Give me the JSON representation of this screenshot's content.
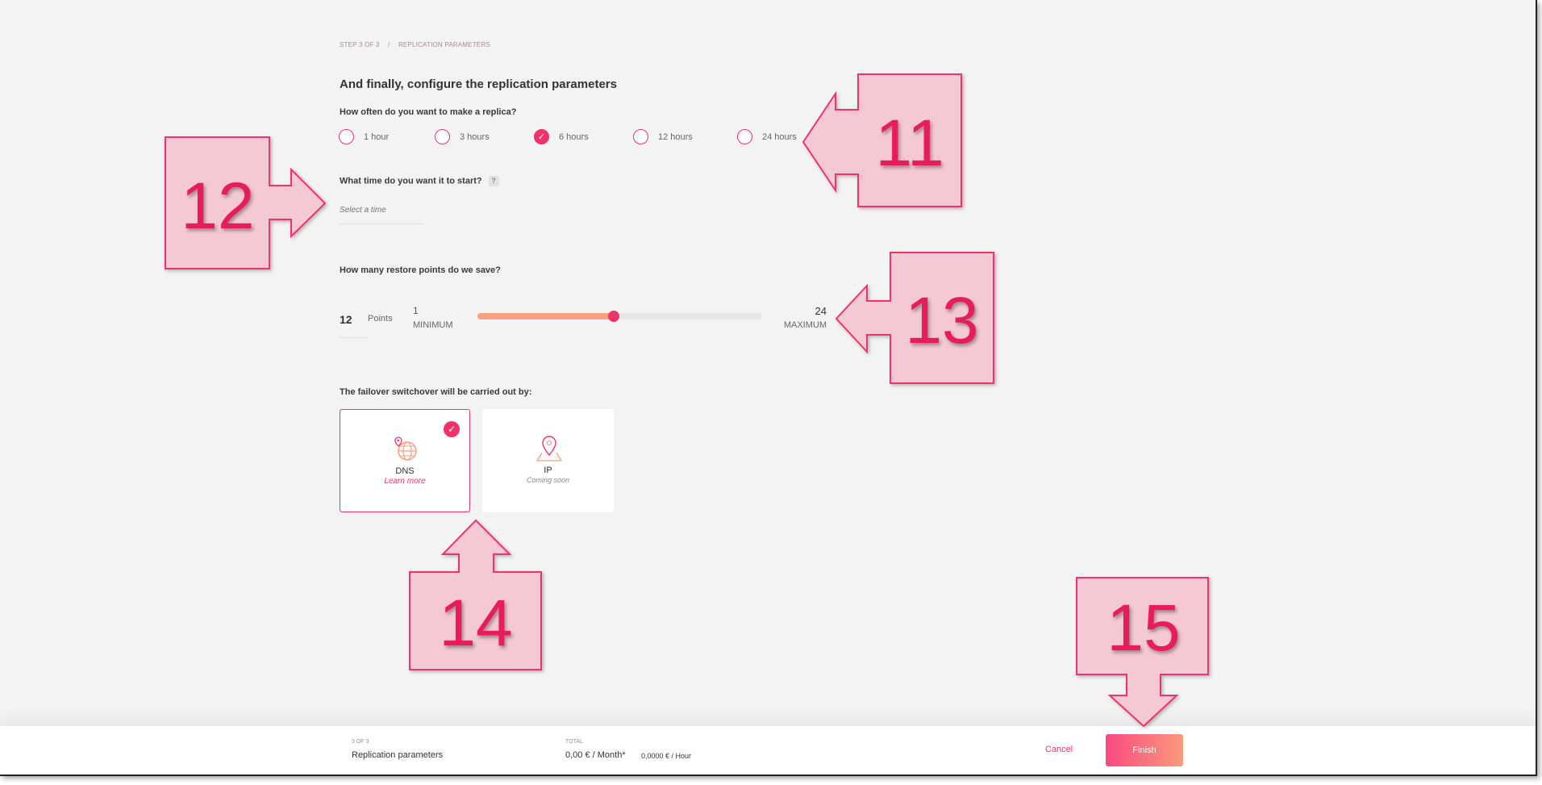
{
  "breadcrumb": {
    "step": "STEP 3 OF 3",
    "separator": "/",
    "current": "REPLICATION PARAMETERS"
  },
  "title": "And finally, configure the replication parameters",
  "frequency": {
    "question": "How often do you want to make a replica?",
    "options": [
      "1 hour",
      "3 hours",
      "6 hours",
      "12 hours",
      "24 hours"
    ],
    "selected": "6 hours"
  },
  "start_time": {
    "question": "What time do you want it to start?",
    "help": "?",
    "placeholder": "Select a time"
  },
  "restore_points": {
    "question": "How many restore points do we save?",
    "value": "12",
    "unit": "Points",
    "min": "1",
    "min_label": "MINIMUM",
    "max": "24",
    "max_label": "MAXIMUM",
    "slider_value": 12
  },
  "failover": {
    "question": "The failover switchover will be carried out by:",
    "options": [
      {
        "name": "DNS",
        "sub": "Learn more",
        "selected": true,
        "icon": "globe-pin-icon"
      },
      {
        "name": "IP",
        "sub": "Coming soon",
        "selected": false,
        "icon": "map-pin-icon"
      }
    ]
  },
  "footer": {
    "step": "3 OF 3",
    "step_name": "Replication parameters",
    "total_label": "TOTAL",
    "monthly": "0,00 € / Month*",
    "hourly": "0,0000 € / Hour",
    "cancel": "Cancel",
    "finish": "Finish"
  },
  "annotations": [
    "11",
    "12",
    "13",
    "14",
    "15"
  ],
  "colors": {
    "accent": "#f0336a",
    "slider_fill": "#f9a080",
    "annotation_fill": "#f4c8d5"
  }
}
